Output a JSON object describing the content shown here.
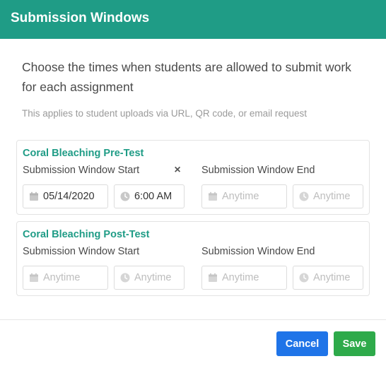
{
  "header": {
    "title": "Submission Windows"
  },
  "body": {
    "intro": "Choose the times when students are allowed to submit work for each assignment",
    "note": "This applies to student uploads via URL, QR code, or email request"
  },
  "assignments": [
    {
      "title": "Coral Bleaching Pre-Test",
      "start_label": "Submission Window Start",
      "end_label": "Submission Window End",
      "clear_icon": "×",
      "start_date": {
        "value": "05/14/2020",
        "placeholder": "Anytime"
      },
      "start_time": {
        "value": "6:00 AM",
        "placeholder": "Anytime"
      },
      "end_date": {
        "value": "",
        "placeholder": "Anytime"
      },
      "end_time": {
        "value": "",
        "placeholder": "Anytime"
      }
    },
    {
      "title": "Coral Bleaching Post-Test",
      "start_label": "Submission Window Start",
      "end_label": "Submission Window End",
      "start_date": {
        "value": "",
        "placeholder": "Anytime"
      },
      "start_time": {
        "value": "",
        "placeholder": "Anytime"
      },
      "end_date": {
        "value": "",
        "placeholder": "Anytime"
      },
      "end_time": {
        "value": "",
        "placeholder": "Anytime"
      }
    }
  ],
  "footer": {
    "cancel_label": "Cancel",
    "save_label": "Save"
  },
  "icons": {
    "date": "calendar-icon",
    "time": "clock-icon",
    "clear": "close-icon"
  },
  "colors": {
    "header": "#1f9c86",
    "cancel": "#1f74e8",
    "save": "#2eaa4a",
    "card_title": "#1f9c86"
  }
}
